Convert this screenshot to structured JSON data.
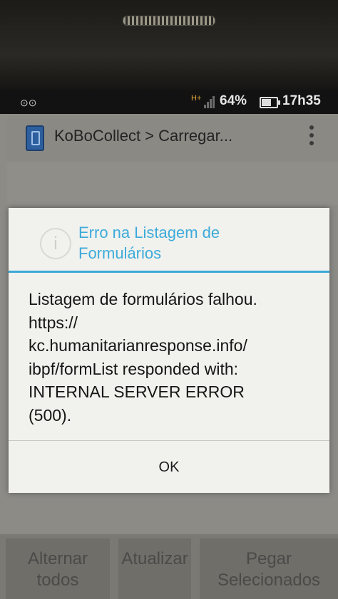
{
  "status_bar": {
    "signal_type": "H+",
    "battery_percent": "64%",
    "battery_level": 0.64,
    "time": "17h35",
    "voicemail_icon": "voicemail-icon"
  },
  "action_bar": {
    "app_icon": "kobo-form-icon",
    "title": "KoBoCollect > Carregar...",
    "overflow_icon": "overflow-menu-icon"
  },
  "dialog": {
    "icon": "info-icon",
    "title_line1": "Erro na Listagem de",
    "title_line2": "Formulários",
    "message_lines": [
      "Listagem de formulários falhou.",
      "https://",
      "kc.humanitarianresponse.info/",
      "ibpf/formList responded with:",
      "INTERNAL SERVER ERROR",
      "(500)."
    ],
    "ok_label": "OK",
    "accent_color": "#3ba9d8"
  },
  "bottom_buttons": {
    "toggle_all": "Alternar todos",
    "update": "Atualizar",
    "get_selected": "Pegar Selecionados"
  }
}
